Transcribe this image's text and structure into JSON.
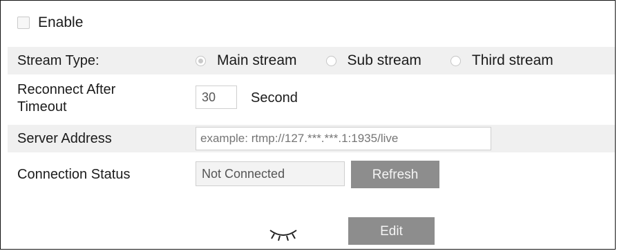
{
  "enable": {
    "label": "Enable",
    "checked": false
  },
  "stream_type": {
    "label": "Stream Type:",
    "options": [
      {
        "label": "Main stream",
        "selected": true
      },
      {
        "label": "Sub stream",
        "selected": false
      },
      {
        "label": "Third stream",
        "selected": false
      }
    ]
  },
  "reconnect": {
    "label_line1": "Reconnect After",
    "label_line2": "Timeout",
    "value": "30",
    "unit": "Second"
  },
  "server_address": {
    "label": "Server Address",
    "placeholder": "example: rtmp://127.***.***.1:1935/live"
  },
  "connection_status": {
    "label": "Connection Status",
    "value": "Not Connected",
    "refresh_label": "Refresh"
  },
  "footer": {
    "eye_icon": "eye-closed-icon",
    "edit_label": "Edit"
  }
}
